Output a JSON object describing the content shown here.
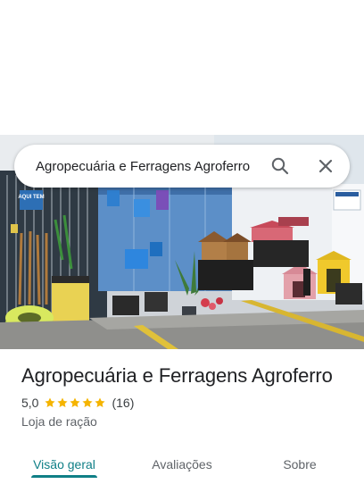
{
  "search": {
    "query": "Agropecuária e Ferragens Agroferro"
  },
  "place": {
    "name": "Agropecuária e Ferragens Agroferro",
    "rating": "5,0",
    "stars": 5,
    "review_count": "(16)",
    "category": "Loja de ração"
  },
  "tabs": [
    {
      "label": "Visão geral",
      "active": true
    },
    {
      "label": "Avaliações",
      "active": false
    },
    {
      "label": "Sobre",
      "active": false
    }
  ],
  "photo": {
    "sign_text": "AQUI TEM"
  },
  "colors": {
    "accent": "#0f7f86",
    "star": "#f5b400",
    "title": "#202124",
    "secondary_text": "#5f6368"
  },
  "icons": {
    "search": "search-icon",
    "close": "close-icon",
    "star": "star-icon"
  }
}
